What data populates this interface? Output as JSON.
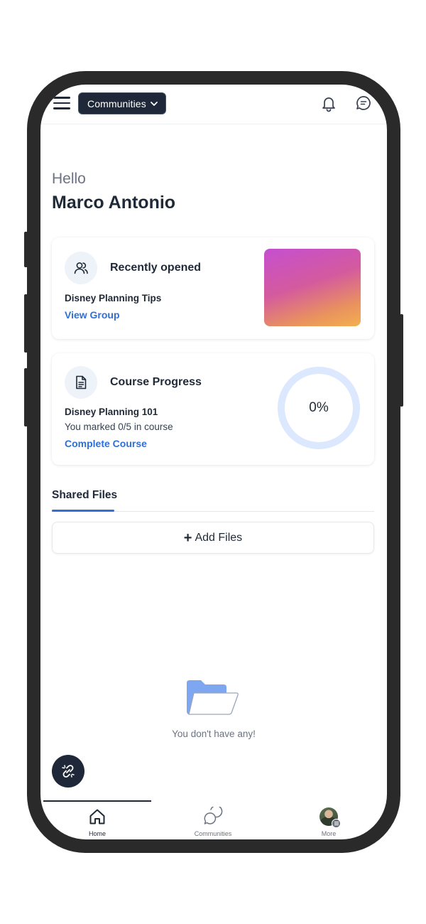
{
  "header": {
    "community_selector": "Communities",
    "icons": [
      "menu-icon",
      "chevron-down-icon",
      "bell-icon",
      "chat-icon"
    ]
  },
  "greeting": {
    "hello": "Hello",
    "name": "Marco Antonio"
  },
  "recently_opened": {
    "title": "Recently opened",
    "group_name": "Disney Planning Tips",
    "link": "View Group",
    "icon": "users-icon",
    "thumbnail_colors": [
      "#c54fd0",
      "#f3b04e"
    ]
  },
  "course_progress": {
    "title": "Course Progress",
    "course_name": "Disney Planning 101",
    "status": "You marked 0/5 in course",
    "link": "Complete Course",
    "percent_label": "0%",
    "progress": 0,
    "icon": "document-icon",
    "ring_color": "#dce8fd"
  },
  "shared_files": {
    "tab_label": "Shared Files",
    "add_button": "+ Add Files",
    "add_button_plus": "+",
    "add_button_text": "Add Files",
    "empty_message": "You don't have any!",
    "empty_icon": "folder-icon"
  },
  "fab": {
    "icon": "link-off-icon"
  },
  "bottom_nav": {
    "items": [
      {
        "label": "Home",
        "icon": "home-icon",
        "active": true
      },
      {
        "label": "Communities",
        "icon": "chat-bubbles-icon",
        "active": false
      },
      {
        "label": "More",
        "icon": "avatar",
        "active": false
      }
    ]
  },
  "colors": {
    "accent": "#2f6fd6",
    "dark": "#1e2838",
    "text": "#1f2937",
    "muted": "#6b7280"
  }
}
